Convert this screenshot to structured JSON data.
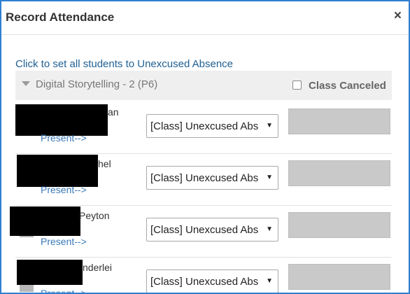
{
  "dialog": {
    "title": "Record Attendance",
    "close_symbol": "×"
  },
  "set_all_link": "Click to set all students to Unexcused Absence",
  "section": {
    "title": "Digital Storytelling - 2 (P6)",
    "cancel_label": "Class Canceled",
    "cancel_checked": false
  },
  "students": [
    {
      "name_visible": "an",
      "present_link": "Present-->",
      "status": "[Class] Unexcused Abs"
    },
    {
      "name_visible": "hel",
      "present_link": "Present-->",
      "status": "[Class] Unexcused Abs"
    },
    {
      "name_visible": "Peyton",
      "present_link": "Present-->",
      "status": "[Class] Unexcused Abs"
    },
    {
      "name_visible": "nderlei",
      "present_link": "Present-->",
      "status": "[Class] Unexcused Abs"
    }
  ],
  "select_arrow": "▼",
  "colors": {
    "dialog_border": "#2f7fd1",
    "link": "#1f5f93",
    "present_link": "#3a79b8",
    "section_bg": "#efefef",
    "comment_box": "#c9c9c9",
    "redaction": "#000000"
  },
  "icons": [
    "close-icon",
    "collapse-triangle-icon",
    "checkbox-icon",
    "select-arrow-icon"
  ]
}
